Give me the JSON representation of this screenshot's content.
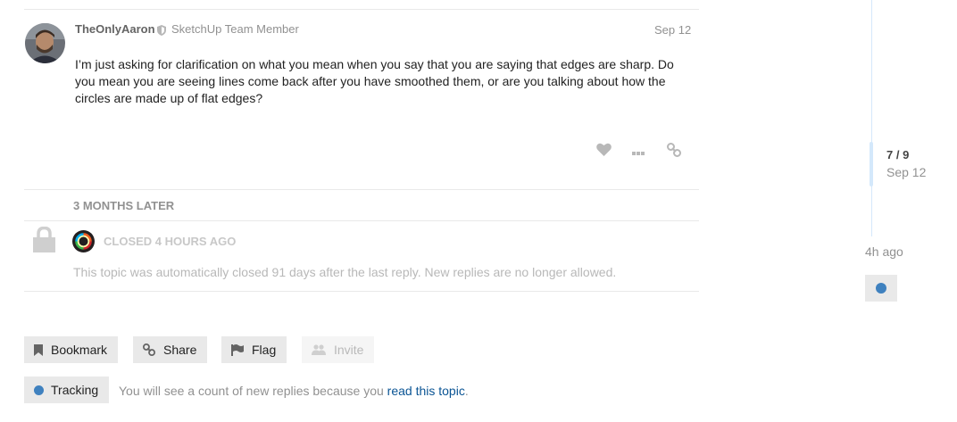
{
  "post": {
    "username": "TheOnlyAaron",
    "user_title": "SketchUp Team Member",
    "date": "Sep 12",
    "body": "I’m just asking for clarification on what you mean when you say that you are saying that edges are sharp. Do you mean you are seeing lines come back after you have smoothed them, or are you talking about how the circles are made up of flat edges?",
    "actions": [
      "heart-icon",
      "ellipsis-icon",
      "link-icon"
    ]
  },
  "time_gap": "3 MONTHS LATER",
  "closed_notice": {
    "label": "CLOSED 4 HOURS AGO",
    "text": "This topic was automatically closed 91 days after the last reply. New replies are no longer allowed."
  },
  "footer_buttons": {
    "bookmark": "Bookmark",
    "share": "Share",
    "flag": "Flag",
    "invite": "Invite"
  },
  "notifications": {
    "level": "Tracking",
    "text_before": "You will see a count of new replies because you ",
    "link": "read this topic",
    "text_after": "."
  },
  "timeline": {
    "position": "7 / 9",
    "date": "Sep 12",
    "last": "4h ago"
  },
  "colors": {
    "accent_blue": "#3f81bf",
    "link": "#0a5494",
    "muted": "#919191"
  }
}
